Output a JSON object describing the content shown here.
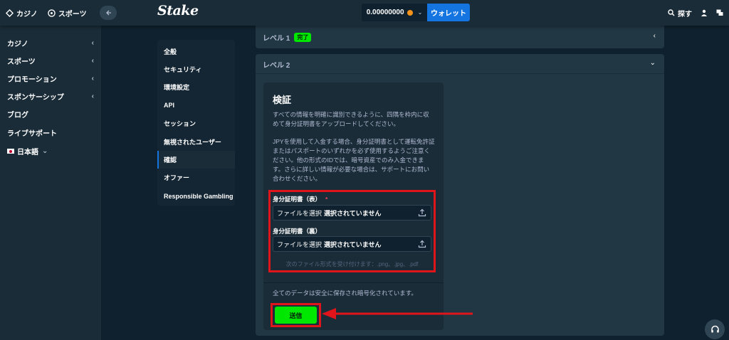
{
  "topbar": {
    "casino": "カジノ",
    "sports": "スポーツ",
    "logo": "Stake",
    "balance": "0.00000000",
    "wallet": "ウォレット",
    "search": "探す"
  },
  "sidebar": {
    "items": [
      {
        "label": "カジノ",
        "chevron": "‹"
      },
      {
        "label": "スポーツ",
        "chevron": "‹"
      },
      {
        "label": "プロモーション",
        "chevron": "‹"
      },
      {
        "label": "スポンサーシップ",
        "chevron": "‹"
      },
      {
        "label": "ブログ"
      },
      {
        "label": "ライブサポート"
      },
      {
        "label": "日本語",
        "chevron": "⌄"
      }
    ]
  },
  "settings_nav": [
    "全般",
    "セキュリティ",
    "環境設定",
    "API",
    "セッション",
    "無視されたユーザー",
    "確認",
    "オファー",
    "Responsible Gambling"
  ],
  "level1": {
    "title": "レベル 1",
    "badge": "完了"
  },
  "level2": {
    "title": "レベル 2"
  },
  "verification": {
    "title": "検証",
    "para1": "すべての情報を明確に識別できるように、四隅を枠内に収めて身分証明書をアップロードしてください。",
    "para2": "JPYを使用して入金する場合、身分証明書として運転免許証またはパスポートのいずれかを必ず使用するようご注意ください。他の形式のIDでは、暗号資産でのみ入金できます。さらに詳しい情報が必要な場合は、サポートにお問い合わせください。",
    "front_label": "身分証明書（表）",
    "required": "*",
    "back_label": "身分証明書（裏）",
    "choose_file": "ファイルを選択",
    "no_file": "選択されていません",
    "accepted": "次のファイル形式を受け付けます：.png、.jpg、.pdf",
    "secure_note": "全てのデータは安全に保存され暗号化されています。",
    "submit": "送信"
  },
  "colors": {
    "bg": "#0f212e",
    "panel": "#213743",
    "accent_blue": "#1475e1",
    "accent_green": "#00e701",
    "highlight_red": "#e0141b"
  }
}
